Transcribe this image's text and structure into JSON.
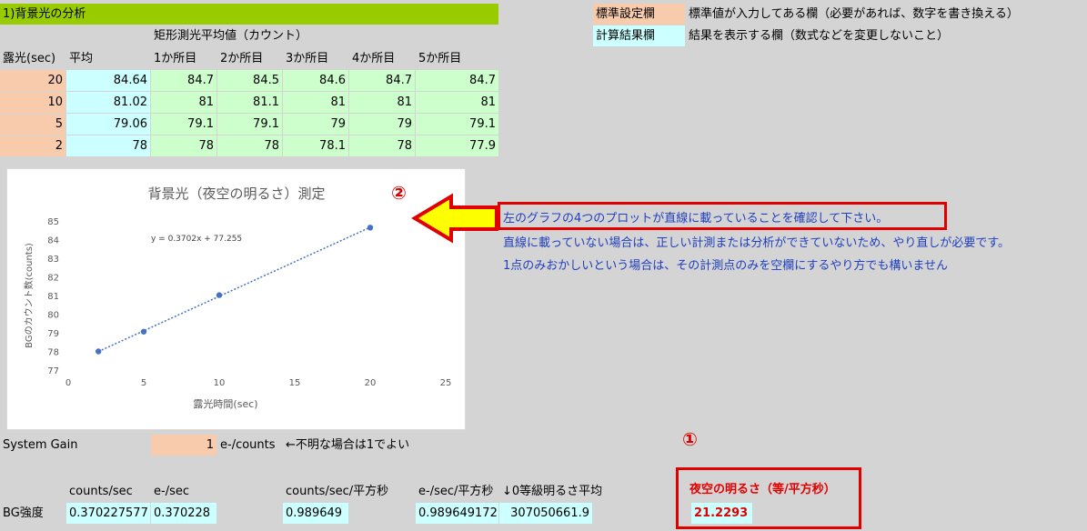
{
  "title": "1)背景光の分析",
  "legend_std": "標準設定欄",
  "legend_std_desc": "標準値が入力してある欄（必要があれば、数字を書き換える）",
  "legend_calc": "計算結果欄",
  "legend_calc_desc": "結果を表示する欄（数式などを変更しないこと）",
  "table": {
    "group_header": "矩形測光平均値（カウント）",
    "headers": [
      "露光(sec)",
      "平均",
      "1か所目",
      "2か所目",
      "3か所目",
      "4か所目",
      "5か所目"
    ],
    "rows": [
      [
        "20",
        "84.64",
        "84.7",
        "84.5",
        "84.6",
        "84.7",
        "84.7"
      ],
      [
        "10",
        "81.02",
        "81",
        "81.1",
        "81",
        "81",
        "81"
      ],
      [
        "5",
        "79.06",
        "79.1",
        "79.1",
        "79",
        "79",
        "79.1"
      ],
      [
        "2",
        "78",
        "78",
        "78",
        "78.1",
        "78",
        "77.9"
      ]
    ]
  },
  "chart_data": {
    "type": "scatter",
    "title": "背景光（夜空の明るさ）測定",
    "xlabel": "露光時間(sec)",
    "ylabel": "BGのカウント数(counts)",
    "xlim": [
      0,
      25
    ],
    "ylim": [
      77,
      85
    ],
    "xticks": [
      "0",
      "5",
      "10",
      "15",
      "20",
      "25"
    ],
    "yticks": [
      "77",
      "78",
      "79",
      "80",
      "81",
      "82",
      "83",
      "84",
      "85"
    ],
    "points": [
      [
        2,
        78
      ],
      [
        5,
        79.06
      ],
      [
        10,
        81.02
      ],
      [
        20,
        84.64
      ]
    ],
    "trendline": {
      "slope": 0.3702,
      "intercept": 77.255,
      "label": "y = 0.3702x + 77.255",
      "style": "dotted"
    },
    "color": "#4472c4"
  },
  "notes": [
    "左のグラフの4つのプロットが直線に載っていることを確認して下さい。",
    "直線に載っていない場合は、正しい計測または分析ができていないため、やり直しが必要です。",
    "1点のみおかしいという場合は、その計測点のみを空欄にするやり方でも構いません"
  ],
  "marker1": "①",
  "marker2": "②",
  "system_gain": {
    "label": "System Gain",
    "value": "1",
    "unit": "e-/counts",
    "note": "←不明な場合は1でよい"
  },
  "bg": {
    "headers": [
      "counts/sec",
      "e-/sec",
      "counts/sec/平方秒",
      "e-/sec/平方秒",
      "0等級明るさ平均"
    ],
    "label": "BG強度",
    "values": [
      "0.370227577",
      "0.370228",
      "0.989649",
      "0.989649172",
      "307050661.9"
    ]
  },
  "sky_brightness": {
    "label": "夜空の明るさ（等/平方秒）",
    "value": "21.2293"
  },
  "colors": {
    "orange": "#f8cbad",
    "cyan": "#ccffff",
    "green": "#ccffcc",
    "title": "#99cc00",
    "note": "#1f3fbf",
    "red": "#e00000"
  }
}
